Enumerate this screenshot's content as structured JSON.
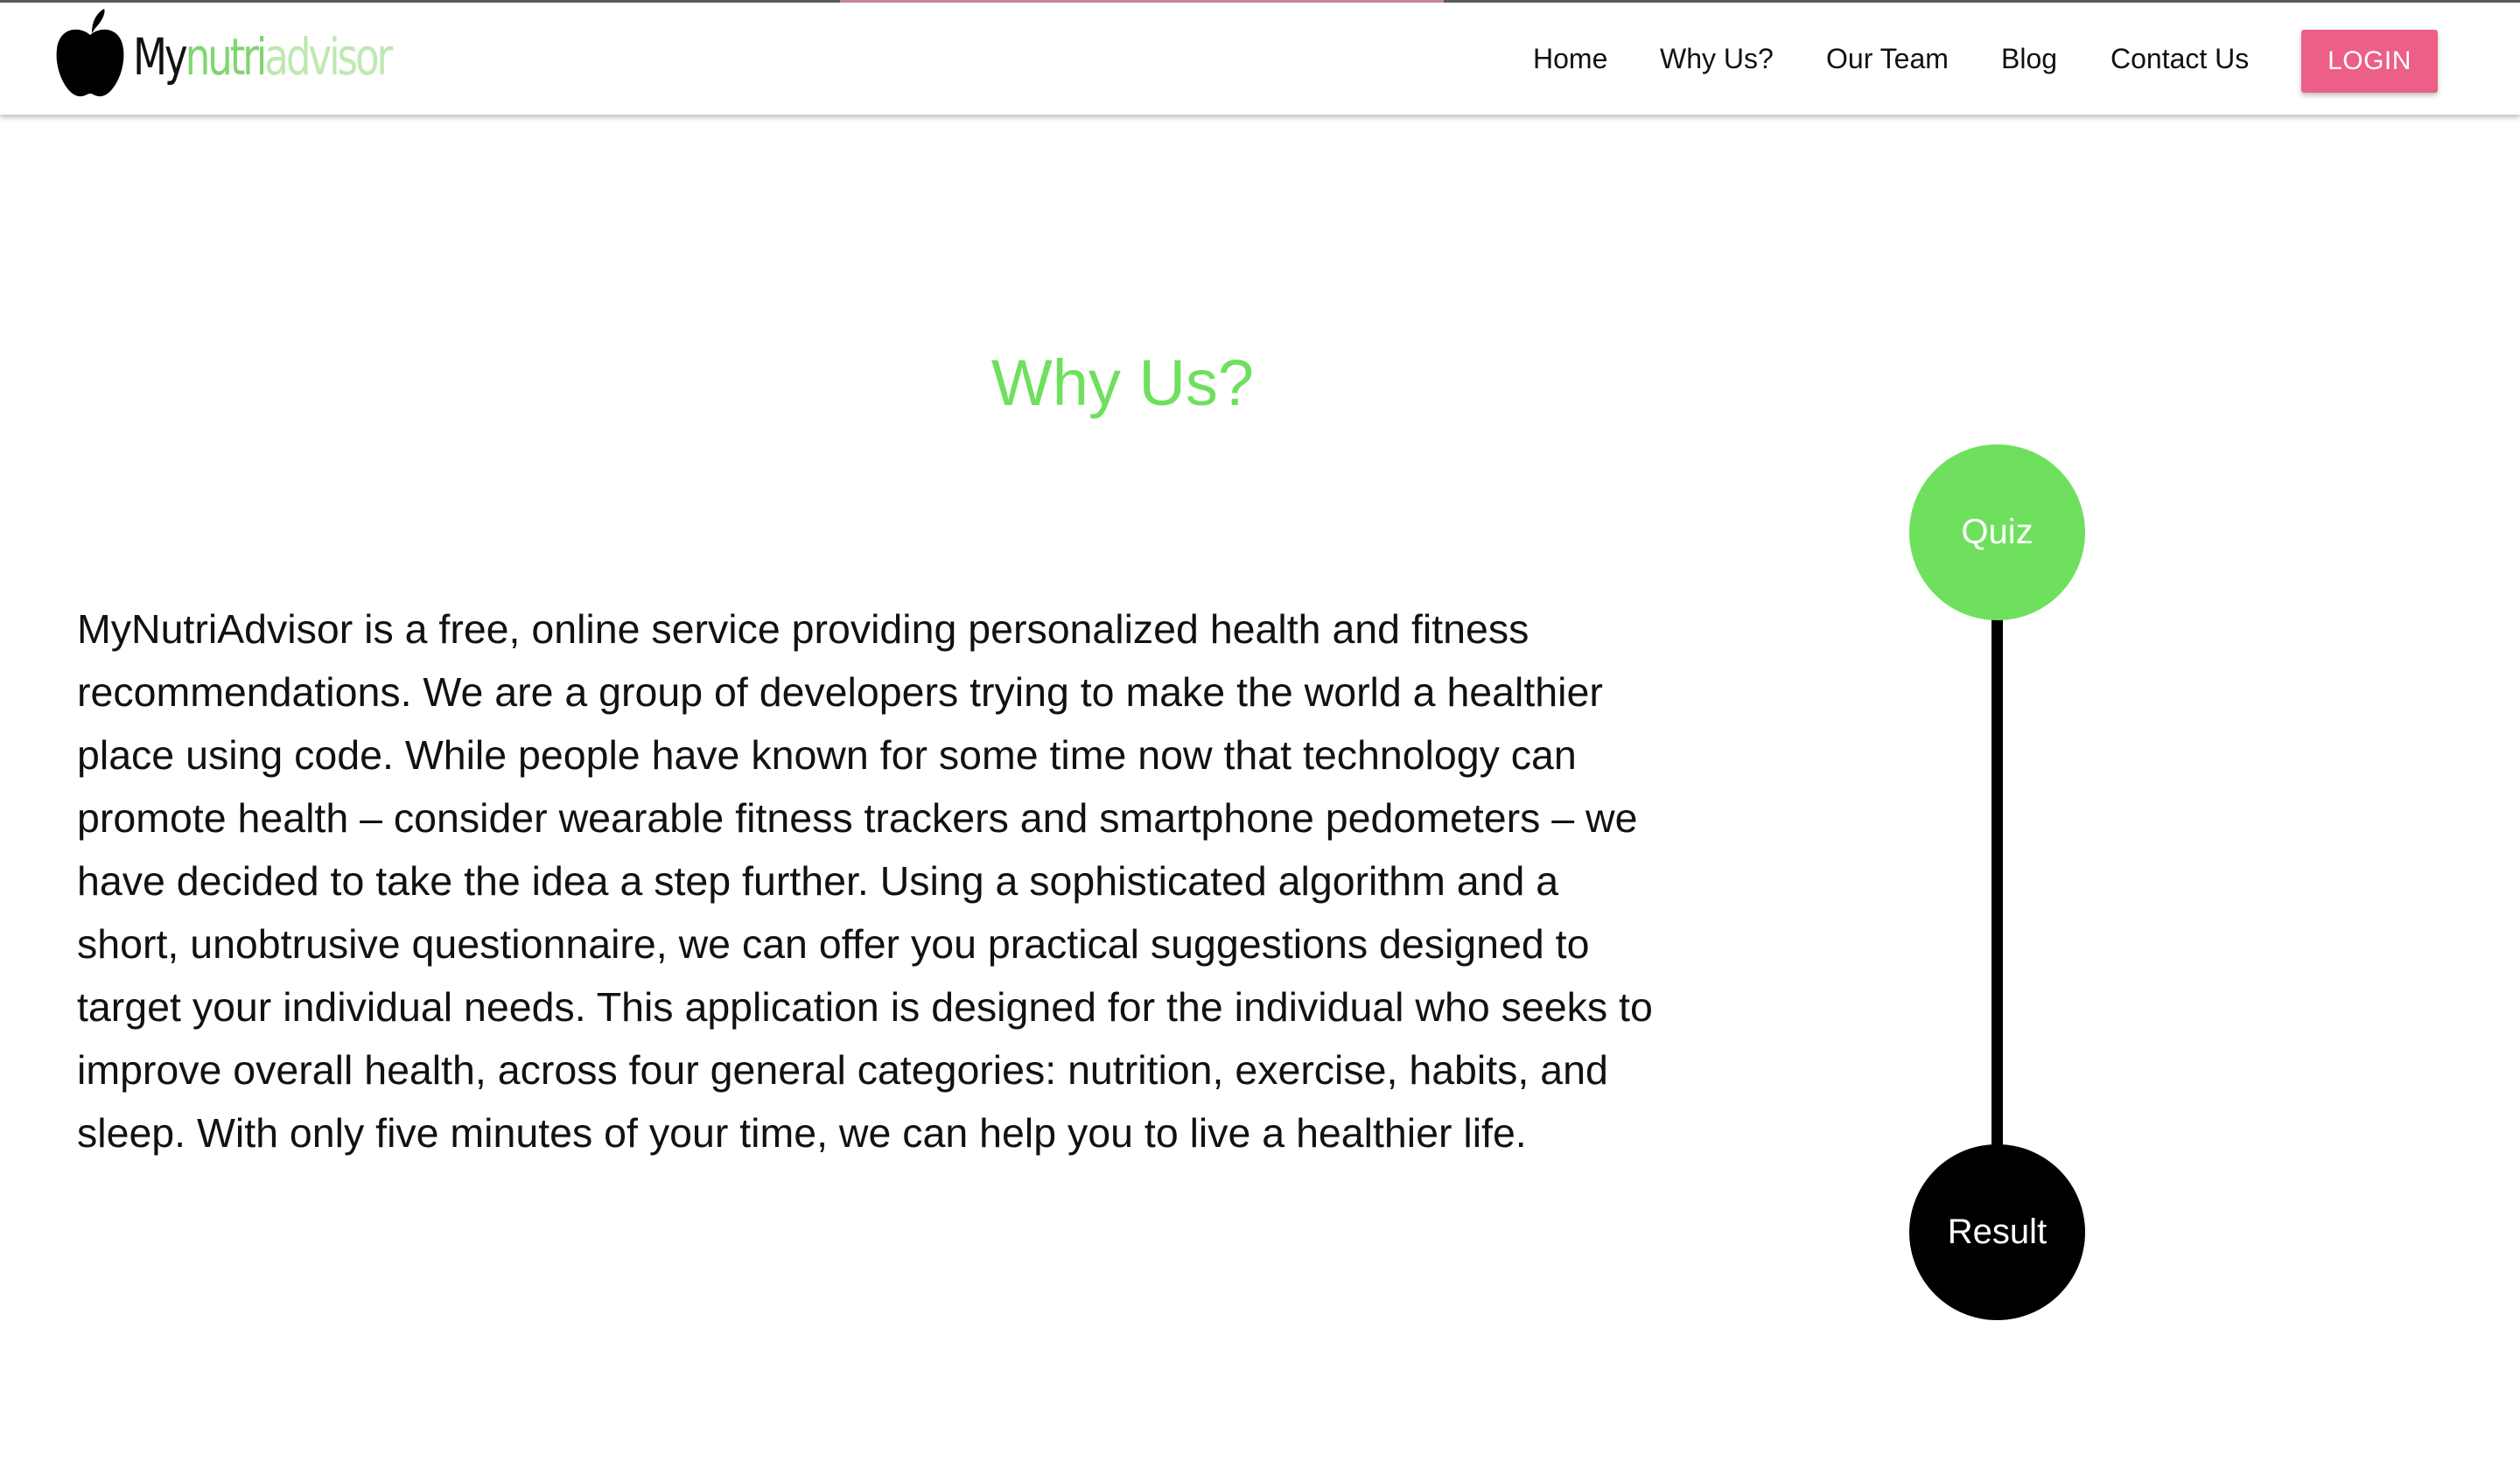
{
  "brand": {
    "part_my": "My",
    "part_nutri": "nutri",
    "part_advisor": "advisor"
  },
  "nav": {
    "items": [
      {
        "label": "Home"
      },
      {
        "label": "Why Us?"
      },
      {
        "label": "Our Team"
      },
      {
        "label": "Blog"
      },
      {
        "label": "Contact Us"
      }
    ],
    "login_label": "LOGIN"
  },
  "main": {
    "title": "Why Us?",
    "description": "MyNutriAdvisor is a free, online service providing personalized health and fitness recommendations. We are a group of developers trying to make the world a healthier place using code. While people have known for some time now that technology can promote health – consider wearable fitness trackers and smartphone pedometers – we have decided to take the idea a step further. Using a sophisticated algorithm and a short, unobtrusive questionnaire, we can offer you practical suggestions designed to target your individual needs. This application is designed for the individual who seeks to improve overall health, across four general categories: nutrition, exercise, habits, and sleep. With only five minutes of your time, we can help you to live a healthier life."
  },
  "timeline": {
    "steps": [
      {
        "label": "Quiz"
      },
      {
        "label": "Result"
      }
    ]
  },
  "colors": {
    "accent_green": "#6fe05e",
    "login_pink": "#ec5f87",
    "logo_nutri_green": "#7fd66e",
    "logo_advisor_green": "#bfe8b2",
    "text_dark": "#111111"
  },
  "icons": {
    "logo": "apple-icon"
  }
}
